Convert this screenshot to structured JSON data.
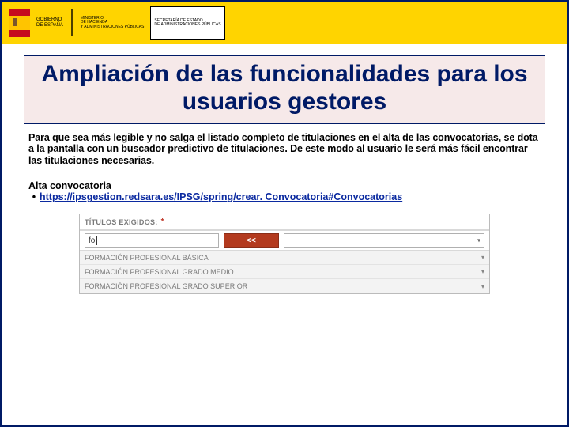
{
  "banner": {
    "gobierno": "GOBIERNO\nDE ESPAÑA",
    "ministerio": "MINISTERIO\nDE HACIENDA\nY ADMINISTRACIONES PÚBLICAS",
    "secretaria_l1": "SECRETARÍA DE ESTADO",
    "secretaria_l2": "DE ADMINISTRACIONES PÚBLICAS"
  },
  "title": "Ampliación de las funcionalidades para los usuarios gestores",
  "intro": "Para que sea más legible y no salga el listado completo de titulaciones en el alta de las convocatorias, se dota a la pantalla con un buscador predictivo de titulaciones. De este modo al usuario le será más fácil encontrar las titulaciones necesarias.",
  "section_label": "Alta convocatoria",
  "bullet_symbol": "•",
  "link_text": "https://ipsgestion.redsara.es/IPSG/spring/crear. Convocatoria#Convocatorias",
  "link_href": "https://ipsgestion.redsara.es/IPSG/spring/crear.Convocatoria#Convocatorias",
  "form": {
    "titulos_label": "TÍTULOS EXIGIDOS:",
    "asterisk": "*",
    "search_value": "fo",
    "add_button": "<<",
    "options": [
      "FORMACIÓN PROFESIONAL BÁSICA",
      "FORMACIÓN PROFESIONAL GRADO MEDIO",
      "FORMACIÓN PROFESIONAL GRADO SUPERIOR"
    ]
  }
}
